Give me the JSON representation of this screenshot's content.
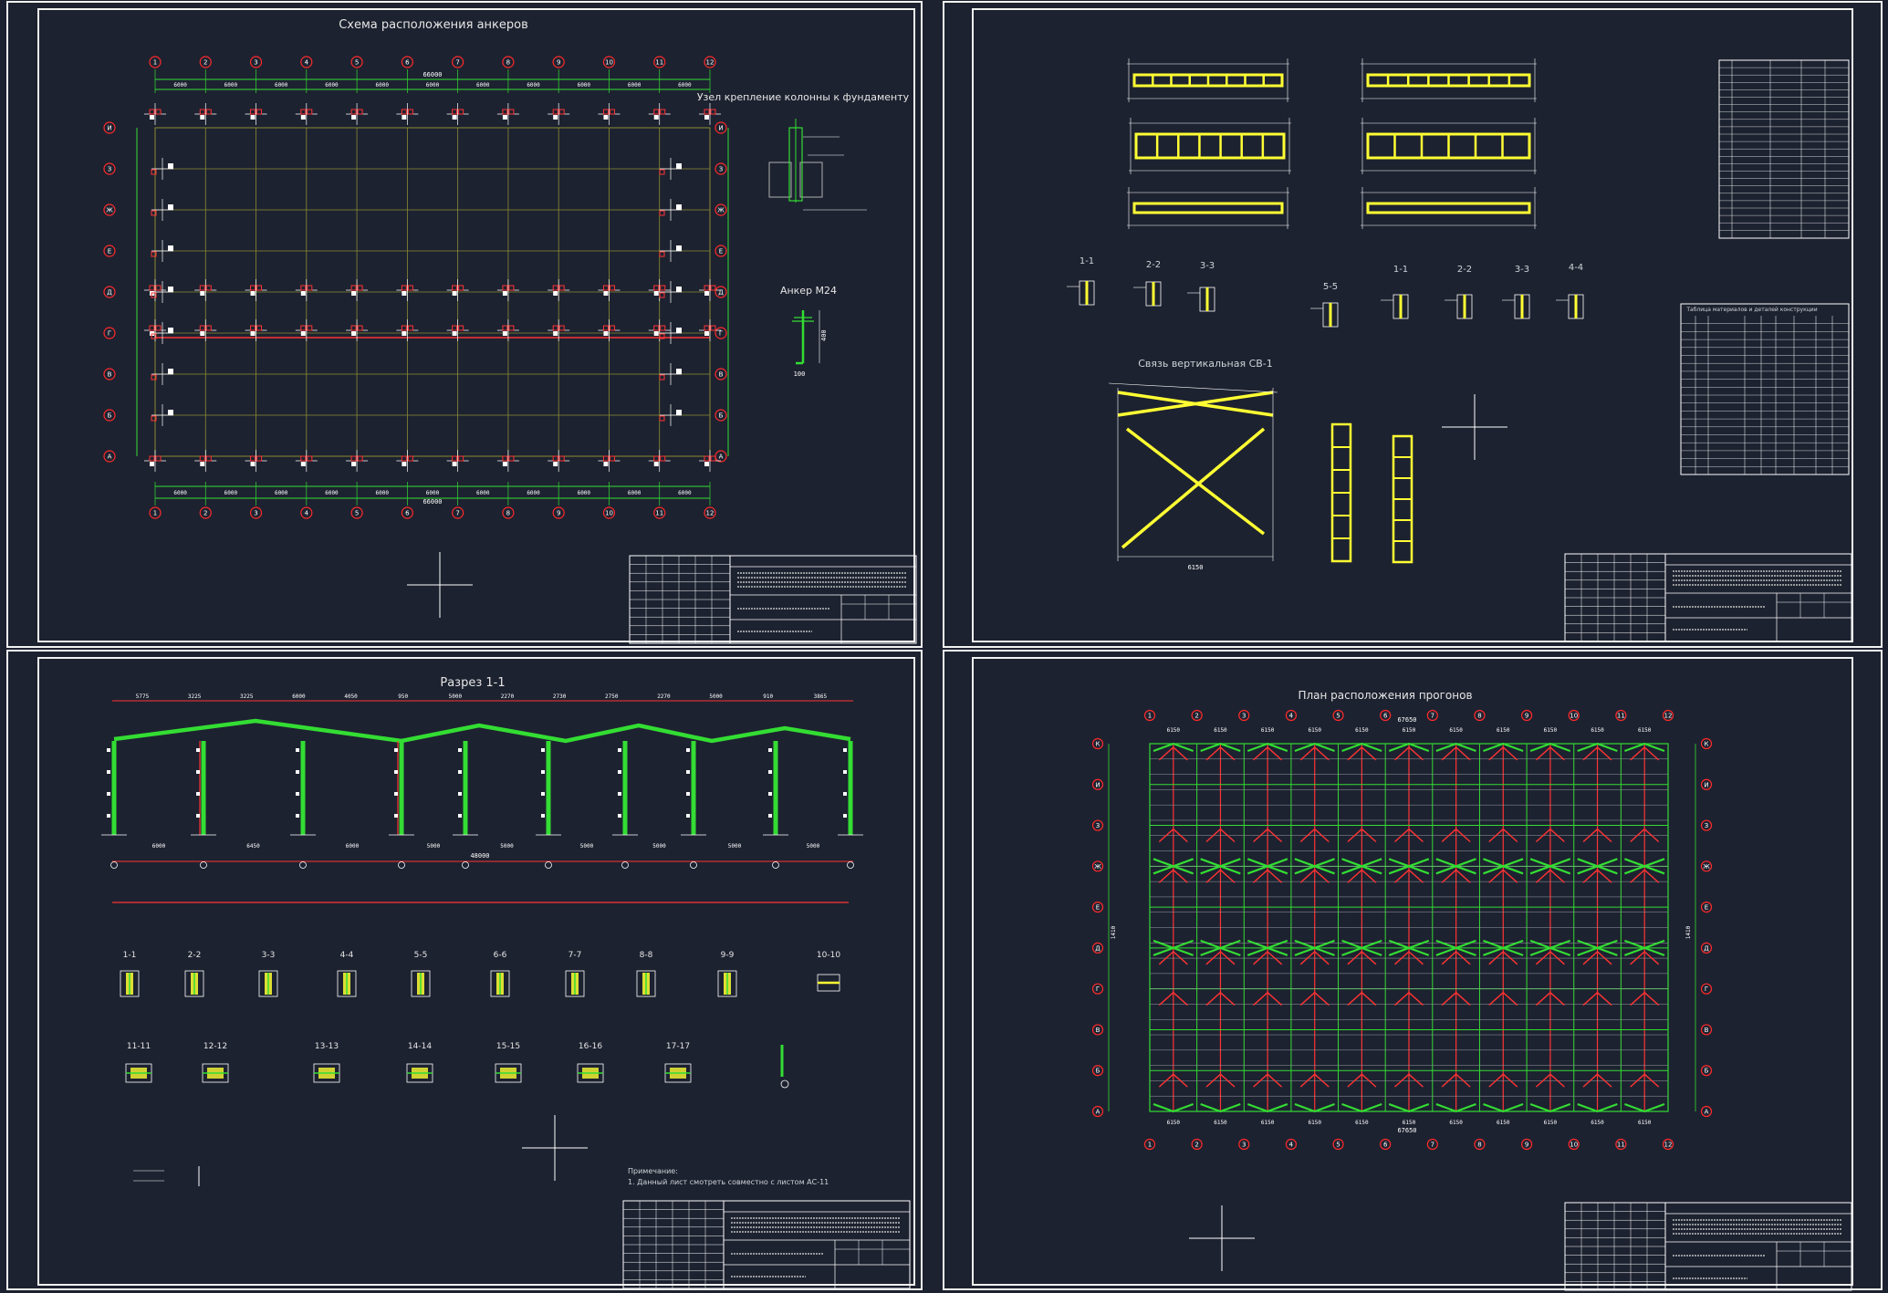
{
  "sheets": {
    "anchors": {
      "title": "Схема расположения анкеров",
      "node_title": "Узел крепление колонны к фундаменту",
      "anchor_title": "Анкер М24",
      "axes_top": [
        "1",
        "2",
        "3",
        "4",
        "5",
        "6",
        "7",
        "8",
        "9",
        "10",
        "11",
        "12"
      ],
      "axes_left": [
        "И",
        "З",
        "Ж",
        "Е",
        "Д",
        "Г",
        "В",
        "Б",
        "А"
      ],
      "bay_dim": "6000",
      "total_dim": "66000",
      "anchor_dim_h": "400",
      "anchor_dim_w": "100"
    },
    "bracing": {
      "sections": [
        "1-1",
        "2-2",
        "3-3",
        "5-5",
        "1-1",
        "2-2",
        "3-3",
        "4-4"
      ],
      "bracing_title": "Связь вертикальная СВ-1",
      "bracing_span": "6150",
      "spec_table_title": "Таблица материалов и деталей конструкции"
    },
    "section": {
      "title": "Разрез 1-1",
      "top_dims": [
        "5775",
        "3225",
        "3225",
        "6000",
        "4050",
        "950",
        "5000",
        "2270",
        "2730",
        "2750",
        "2270",
        "5000",
        "910",
        "3865"
      ],
      "bottom_dims": [
        "6000",
        "6450",
        "6000",
        "5000",
        "5000",
        "5000",
        "5000",
        "5000",
        "5000"
      ],
      "total_dim": "48000",
      "details_row1": [
        "1-1",
        "2-2",
        "3-3",
        "4-4",
        "5-5",
        "6-6",
        "7-7",
        "8-8",
        "9-9",
        "10-10"
      ],
      "details_row2": [
        "11-11",
        "12-12",
        "13-13",
        "14-14",
        "15-15",
        "16-16",
        "17-17"
      ],
      "note_title": "Примечание:",
      "note_text": "1. Данный лист смотреть совместно с листом АС-11"
    },
    "purlins": {
      "title": "План расположения прогонов",
      "axes_top": [
        "1",
        "2",
        "3",
        "4",
        "5",
        "6",
        "7",
        "8",
        "9",
        "10",
        "11",
        "12"
      ],
      "axes_left": [
        "К",
        "И",
        "З",
        "Ж",
        "Е",
        "Д",
        "Г",
        "В",
        "Б",
        "А"
      ],
      "bay_dim": "6150",
      "total_dim": "67650",
      "side_dim": "1410"
    }
  },
  "colors": {
    "background": "#1d2230",
    "frame": "#ffffff",
    "green": "#33dd33",
    "yellow": "#ffff33",
    "red": "#ff3333",
    "axis_circle": "#ff2a2a",
    "grid_olive": "#8c8c32"
  }
}
